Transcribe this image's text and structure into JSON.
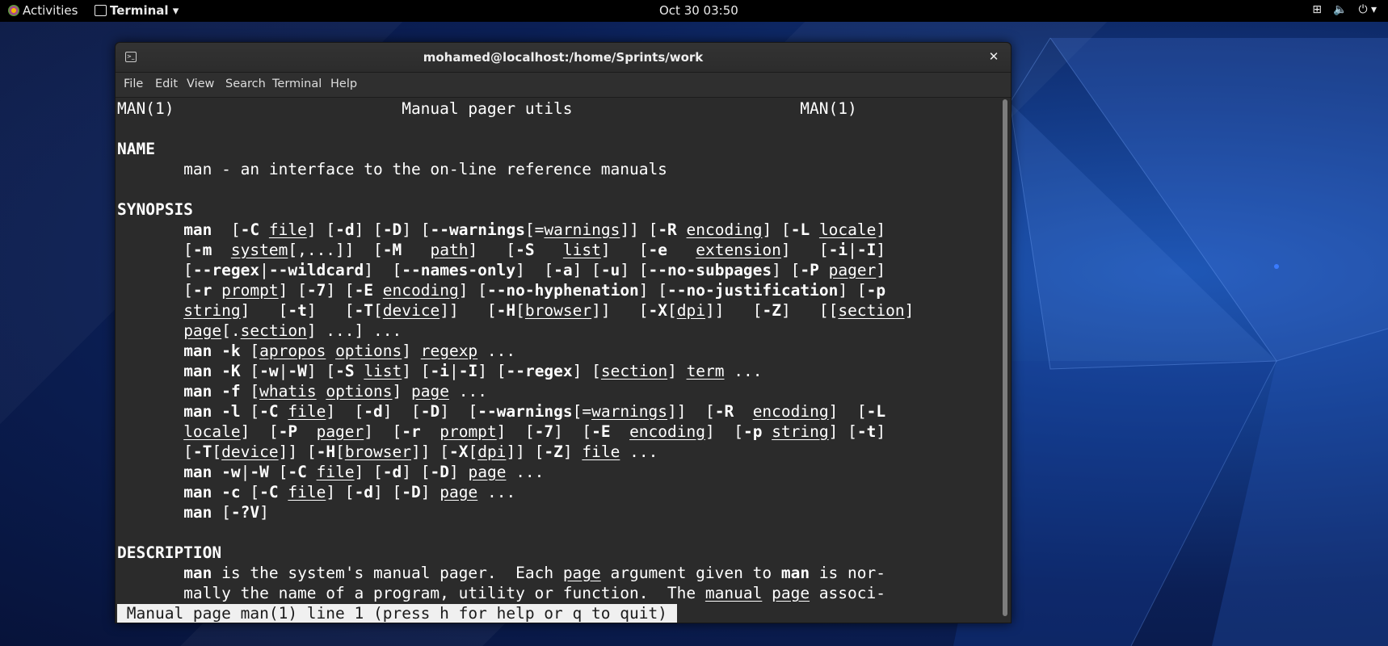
{
  "topbar": {
    "activities": "Activities",
    "app_menu": "Terminal",
    "clock": "Oct 30  03:50",
    "tray_icons": [
      "network-icon",
      "volume-icon",
      "power-icon"
    ]
  },
  "window": {
    "title": "mohamed@localhost:/home/Sprints/work",
    "close_glyph": "✕"
  },
  "menu": {
    "file": "File",
    "edit": "Edit",
    "view": "View",
    "search": "Search",
    "terminal": "Terminal",
    "help": "Help"
  },
  "terminal_lines": [
    [
      {
        "t": "MAN(1)                        Manual pager utils                        MAN(1)"
      }
    ],
    [
      {
        "t": ""
      }
    ],
    [
      {
        "t": "NAME",
        "s": "b"
      }
    ],
    [
      {
        "t": "       man - an interface to the on-line reference manuals"
      }
    ],
    [
      {
        "t": ""
      }
    ],
    [
      {
        "t": "SYNOPSIS",
        "s": "b"
      }
    ],
    [
      {
        "t": "       "
      },
      {
        "t": "man",
        "s": "b"
      },
      {
        "t": "  ["
      },
      {
        "t": "-C",
        "s": "b"
      },
      {
        "t": " "
      },
      {
        "t": "file",
        "s": "u"
      },
      {
        "t": "] ["
      },
      {
        "t": "-d",
        "s": "b"
      },
      {
        "t": "] ["
      },
      {
        "t": "-D",
        "s": "b"
      },
      {
        "t": "] ["
      },
      {
        "t": "--warnings",
        "s": "b"
      },
      {
        "t": "[="
      },
      {
        "t": "warnings",
        "s": "u"
      },
      {
        "t": "]] ["
      },
      {
        "t": "-R",
        "s": "b"
      },
      {
        "t": " "
      },
      {
        "t": "encoding",
        "s": "u"
      },
      {
        "t": "] ["
      },
      {
        "t": "-L",
        "s": "b"
      },
      {
        "t": " "
      },
      {
        "t": "locale",
        "s": "u"
      },
      {
        "t": "]"
      }
    ],
    [
      {
        "t": "       ["
      },
      {
        "t": "-m",
        "s": "b"
      },
      {
        "t": "  "
      },
      {
        "t": "system",
        "s": "u"
      },
      {
        "t": "[,...]]  ["
      },
      {
        "t": "-M",
        "s": "b"
      },
      {
        "t": "   "
      },
      {
        "t": "path",
        "s": "u"
      },
      {
        "t": "]   ["
      },
      {
        "t": "-S",
        "s": "b"
      },
      {
        "t": "   "
      },
      {
        "t": "list",
        "s": "u"
      },
      {
        "t": "]   ["
      },
      {
        "t": "-e",
        "s": "b"
      },
      {
        "t": "   "
      },
      {
        "t": "extension",
        "s": "u"
      },
      {
        "t": "]   ["
      },
      {
        "t": "-i",
        "s": "b"
      },
      {
        "t": "|"
      },
      {
        "t": "-I",
        "s": "b"
      },
      {
        "t": "]"
      }
    ],
    [
      {
        "t": "       ["
      },
      {
        "t": "--regex",
        "s": "b"
      },
      {
        "t": "|"
      },
      {
        "t": "--wildcard",
        "s": "b"
      },
      {
        "t": "]  ["
      },
      {
        "t": "--names-only",
        "s": "b"
      },
      {
        "t": "]  ["
      },
      {
        "t": "-a",
        "s": "b"
      },
      {
        "t": "] ["
      },
      {
        "t": "-u",
        "s": "b"
      },
      {
        "t": "] ["
      },
      {
        "t": "--no-subpages",
        "s": "b"
      },
      {
        "t": "] ["
      },
      {
        "t": "-P",
        "s": "b"
      },
      {
        "t": " "
      },
      {
        "t": "pager",
        "s": "u"
      },
      {
        "t": "]"
      }
    ],
    [
      {
        "t": "       ["
      },
      {
        "t": "-r",
        "s": "b"
      },
      {
        "t": " "
      },
      {
        "t": "prompt",
        "s": "u"
      },
      {
        "t": "] ["
      },
      {
        "t": "-7",
        "s": "b"
      },
      {
        "t": "] ["
      },
      {
        "t": "-E",
        "s": "b"
      },
      {
        "t": " "
      },
      {
        "t": "encoding",
        "s": "u"
      },
      {
        "t": "] ["
      },
      {
        "t": "--no-hyphenation",
        "s": "b"
      },
      {
        "t": "] ["
      },
      {
        "t": "--no-justification",
        "s": "b"
      },
      {
        "t": "] ["
      },
      {
        "t": "-p",
        "s": "b"
      }
    ],
    [
      {
        "t": "       "
      },
      {
        "t": "string",
        "s": "u"
      },
      {
        "t": "]   ["
      },
      {
        "t": "-t",
        "s": "b"
      },
      {
        "t": "]   ["
      },
      {
        "t": "-T",
        "s": "b"
      },
      {
        "t": "["
      },
      {
        "t": "device",
        "s": "u"
      },
      {
        "t": "]]   ["
      },
      {
        "t": "-H",
        "s": "b"
      },
      {
        "t": "["
      },
      {
        "t": "browser",
        "s": "u"
      },
      {
        "t": "]]   ["
      },
      {
        "t": "-X",
        "s": "b"
      },
      {
        "t": "["
      },
      {
        "t": "dpi",
        "s": "u"
      },
      {
        "t": "]]   ["
      },
      {
        "t": "-Z",
        "s": "b"
      },
      {
        "t": "]   [["
      },
      {
        "t": "section",
        "s": "u"
      },
      {
        "t": "]"
      }
    ],
    [
      {
        "t": "       "
      },
      {
        "t": "page",
        "s": "u"
      },
      {
        "t": "[."
      },
      {
        "t": "section",
        "s": "u"
      },
      {
        "t": "] ...] ..."
      }
    ],
    [
      {
        "t": "       "
      },
      {
        "t": "man -k",
        "s": "b"
      },
      {
        "t": " ["
      },
      {
        "t": "apropos",
        "s": "u"
      },
      {
        "t": " "
      },
      {
        "t": "options",
        "s": "u"
      },
      {
        "t": "] "
      },
      {
        "t": "regexp",
        "s": "u"
      },
      {
        "t": " ..."
      }
    ],
    [
      {
        "t": "       "
      },
      {
        "t": "man -K",
        "s": "b"
      },
      {
        "t": " ["
      },
      {
        "t": "-w",
        "s": "b"
      },
      {
        "t": "|"
      },
      {
        "t": "-W",
        "s": "b"
      },
      {
        "t": "] ["
      },
      {
        "t": "-S",
        "s": "b"
      },
      {
        "t": " "
      },
      {
        "t": "list",
        "s": "u"
      },
      {
        "t": "] ["
      },
      {
        "t": "-i",
        "s": "b"
      },
      {
        "t": "|"
      },
      {
        "t": "-I",
        "s": "b"
      },
      {
        "t": "] ["
      },
      {
        "t": "--regex",
        "s": "b"
      },
      {
        "t": "] ["
      },
      {
        "t": "section",
        "s": "u"
      },
      {
        "t": "] "
      },
      {
        "t": "term",
        "s": "u"
      },
      {
        "t": " ..."
      }
    ],
    [
      {
        "t": "       "
      },
      {
        "t": "man -f",
        "s": "b"
      },
      {
        "t": " ["
      },
      {
        "t": "whatis",
        "s": "u"
      },
      {
        "t": " "
      },
      {
        "t": "options",
        "s": "u"
      },
      {
        "t": "] "
      },
      {
        "t": "page",
        "s": "u"
      },
      {
        "t": " ..."
      }
    ],
    [
      {
        "t": "       "
      },
      {
        "t": "man -l",
        "s": "b"
      },
      {
        "t": " ["
      },
      {
        "t": "-C",
        "s": "b"
      },
      {
        "t": " "
      },
      {
        "t": "file",
        "s": "u"
      },
      {
        "t": "]  ["
      },
      {
        "t": "-d",
        "s": "b"
      },
      {
        "t": "]  ["
      },
      {
        "t": "-D",
        "s": "b"
      },
      {
        "t": "]  ["
      },
      {
        "t": "--warnings",
        "s": "b"
      },
      {
        "t": "[="
      },
      {
        "t": "warnings",
        "s": "u"
      },
      {
        "t": "]]  ["
      },
      {
        "t": "-R",
        "s": "b"
      },
      {
        "t": "  "
      },
      {
        "t": "encoding",
        "s": "u"
      },
      {
        "t": "]  ["
      },
      {
        "t": "-L",
        "s": "b"
      }
    ],
    [
      {
        "t": "       "
      },
      {
        "t": "locale",
        "s": "u"
      },
      {
        "t": "]  ["
      },
      {
        "t": "-P",
        "s": "b"
      },
      {
        "t": "  "
      },
      {
        "t": "pager",
        "s": "u"
      },
      {
        "t": "]  ["
      },
      {
        "t": "-r",
        "s": "b"
      },
      {
        "t": "  "
      },
      {
        "t": "prompt",
        "s": "u"
      },
      {
        "t": "]  ["
      },
      {
        "t": "-7",
        "s": "b"
      },
      {
        "t": "]  ["
      },
      {
        "t": "-E",
        "s": "b"
      },
      {
        "t": "  "
      },
      {
        "t": "encoding",
        "s": "u"
      },
      {
        "t": "]  ["
      },
      {
        "t": "-p",
        "s": "b"
      },
      {
        "t": " "
      },
      {
        "t": "string",
        "s": "u"
      },
      {
        "t": "] ["
      },
      {
        "t": "-t",
        "s": "b"
      },
      {
        "t": "]"
      }
    ],
    [
      {
        "t": "       ["
      },
      {
        "t": "-T",
        "s": "b"
      },
      {
        "t": "["
      },
      {
        "t": "device",
        "s": "u"
      },
      {
        "t": "]] ["
      },
      {
        "t": "-H",
        "s": "b"
      },
      {
        "t": "["
      },
      {
        "t": "browser",
        "s": "u"
      },
      {
        "t": "]] ["
      },
      {
        "t": "-X",
        "s": "b"
      },
      {
        "t": "["
      },
      {
        "t": "dpi",
        "s": "u"
      },
      {
        "t": "]] ["
      },
      {
        "t": "-Z",
        "s": "b"
      },
      {
        "t": "] "
      },
      {
        "t": "file",
        "s": "u"
      },
      {
        "t": " ..."
      }
    ],
    [
      {
        "t": "       "
      },
      {
        "t": "man -w",
        "s": "b"
      },
      {
        "t": "|"
      },
      {
        "t": "-W",
        "s": "b"
      },
      {
        "t": " ["
      },
      {
        "t": "-C",
        "s": "b"
      },
      {
        "t": " "
      },
      {
        "t": "file",
        "s": "u"
      },
      {
        "t": "] ["
      },
      {
        "t": "-d",
        "s": "b"
      },
      {
        "t": "] ["
      },
      {
        "t": "-D",
        "s": "b"
      },
      {
        "t": "] "
      },
      {
        "t": "page",
        "s": "u"
      },
      {
        "t": " ..."
      }
    ],
    [
      {
        "t": "       "
      },
      {
        "t": "man -c",
        "s": "b"
      },
      {
        "t": " ["
      },
      {
        "t": "-C",
        "s": "b"
      },
      {
        "t": " "
      },
      {
        "t": "file",
        "s": "u"
      },
      {
        "t": "] ["
      },
      {
        "t": "-d",
        "s": "b"
      },
      {
        "t": "] ["
      },
      {
        "t": "-D",
        "s": "b"
      },
      {
        "t": "] "
      },
      {
        "t": "page",
        "s": "u"
      },
      {
        "t": " ..."
      }
    ],
    [
      {
        "t": "       "
      },
      {
        "t": "man",
        "s": "b"
      },
      {
        "t": " ["
      },
      {
        "t": "-?V",
        "s": "b"
      },
      {
        "t": "]"
      }
    ],
    [
      {
        "t": ""
      }
    ],
    [
      {
        "t": "DESCRIPTION",
        "s": "b"
      }
    ],
    [
      {
        "t": "       "
      },
      {
        "t": "man",
        "s": "b"
      },
      {
        "t": " is the system's manual pager.  Each "
      },
      {
        "t": "page",
        "s": "u"
      },
      {
        "t": " argument given to "
      },
      {
        "t": "man",
        "s": "b"
      },
      {
        "t": " is nor-"
      }
    ],
    [
      {
        "t": "       mally the name of a program, utility or function.  The "
      },
      {
        "t": "manual",
        "s": "u"
      },
      {
        "t": " "
      },
      {
        "t": "page",
        "s": "u"
      },
      {
        "t": " associ-"
      }
    ],
    [
      {
        "t": " Manual page man(1) line 1 (press h for help or q to quit) ",
        "s": "status"
      }
    ]
  ]
}
